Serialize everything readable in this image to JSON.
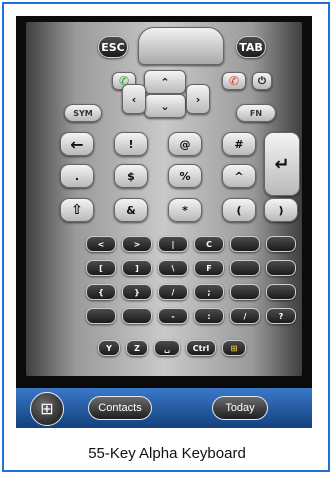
{
  "keys": {
    "esc": "ESC",
    "tab": "TAB",
    "sym": "SYM",
    "fn": "FN",
    "row1": [
      "!",
      "@",
      "#"
    ],
    "row2": [
      ".",
      "$",
      "%",
      "^"
    ],
    "row3": [
      "&",
      "*",
      "(",
      ")"
    ],
    "r4": [
      "<",
      ">",
      "|",
      "C"
    ],
    "r5": [
      "[",
      "]",
      "\\",
      "F"
    ],
    "r6": [
      "{",
      "}",
      "/",
      ";"
    ],
    "r7": [
      "-",
      ":",
      "/",
      "?"
    ],
    "bottom": [
      "Y",
      "Z",
      "Ctrl"
    ]
  },
  "taskbar": {
    "contacts": "Contacts",
    "today": "Today"
  },
  "caption": "55-Key Alpha Keyboard",
  "colors": {
    "border": "#1e73d8",
    "taskbar": "#2a5ea6",
    "call": "#2aa52a",
    "end": "#e03a2a"
  }
}
